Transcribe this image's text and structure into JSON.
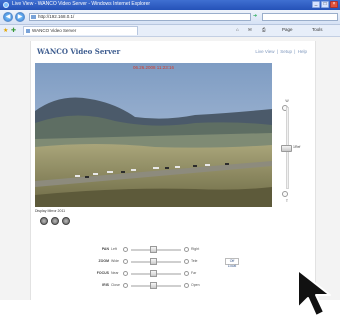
{
  "window": {
    "title": "Live View - WANCO Video Server - Windows Internet Explorer"
  },
  "addressbar": {
    "url": "http://192.168.0.1/"
  },
  "tab": {
    "label": "WANCO Video Server"
  },
  "commandbar": {
    "home": "⌂",
    "feeds": "✉",
    "print": "⎙",
    "page": "Page",
    "tools": "Tools"
  },
  "site": {
    "brand": "WANCO Video Server",
    "menu": [
      "Live View",
      "|",
      "Setup",
      "|",
      "Help"
    ]
  },
  "video": {
    "timestamp": "06.26.2008 11:23:16",
    "caption": "Display Mirror 2011"
  },
  "zoom_slider": {
    "top_label": "W",
    "bottom_label": "T",
    "knob_label": "1Ref",
    "fill": 0.55
  },
  "ptz": {
    "rows": [
      {
        "label": "PAN",
        "left": "Left",
        "right": "Right",
        "position": 0.45
      },
      {
        "label": "ZOOM",
        "left": "Wide",
        "right": "Tele",
        "position": 0.45
      },
      {
        "label": "FOCUS",
        "left": "Near",
        "right": "Far",
        "position": 0.45
      },
      {
        "label": "IRIS",
        "left": "Close",
        "right": "Open",
        "position": 0.45
      }
    ],
    "autofocus_label": "Off Locat"
  }
}
